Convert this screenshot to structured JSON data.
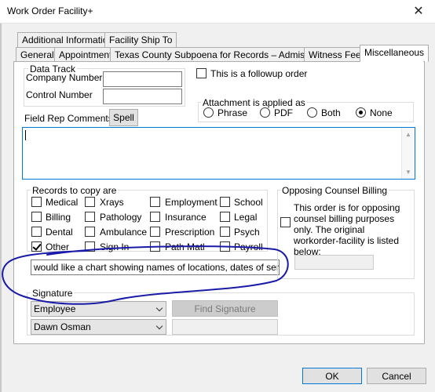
{
  "window": {
    "title": "Work Order Facility+"
  },
  "tabs_row1": [
    "Additional Information",
    "Facility Ship To"
  ],
  "tabs_row2": [
    "General",
    "Appointment",
    "Texas County Subpoena for Records – Admissible",
    "Witness Fee",
    "Miscellaneous"
  ],
  "data_track": {
    "title": "Data Track",
    "company_number_label": "Company Number",
    "control_number_label": "Control Number",
    "company_number_value": "",
    "control_number_value": ""
  },
  "followup": {
    "label": "This is a followup order",
    "checked": false
  },
  "attachment": {
    "title": "Attachment is applied as",
    "options": [
      "Phrase",
      "PDF",
      "Both",
      "None"
    ],
    "selected": "None"
  },
  "field_rep": {
    "label": "Field Rep Comments",
    "spell_button": "Spell",
    "value": ""
  },
  "records": {
    "title": "Records to copy are",
    "col1": [
      "Medical",
      "Billing",
      "Dental",
      "Other"
    ],
    "col2": [
      "Xrays",
      "Pathology",
      "Ambulance",
      "Sign In"
    ],
    "col3": [
      "Employment",
      "Insurance",
      "Prescription",
      "Path Matl"
    ],
    "col4": [
      "School",
      "Legal",
      "Psych",
      "Payroll"
    ],
    "checked": [
      "Other"
    ],
    "other_text": "would like a chart showing names of locations, dates of servi"
  },
  "opposing": {
    "title": "Opposing Counsel Billing",
    "text": "This order is for opposing counsel billing purposes only. The original workorder-facility is listed below:"
  },
  "signature": {
    "title": "Signature",
    "type_value": "Employee",
    "name_value": "Dawn Osman",
    "find_button": "Find Signature"
  },
  "buttons": {
    "ok": "OK",
    "cancel": "Cancel"
  },
  "colors": {
    "annotation_ink": "#1a1aa8",
    "focus_blue": "#0078d7"
  }
}
